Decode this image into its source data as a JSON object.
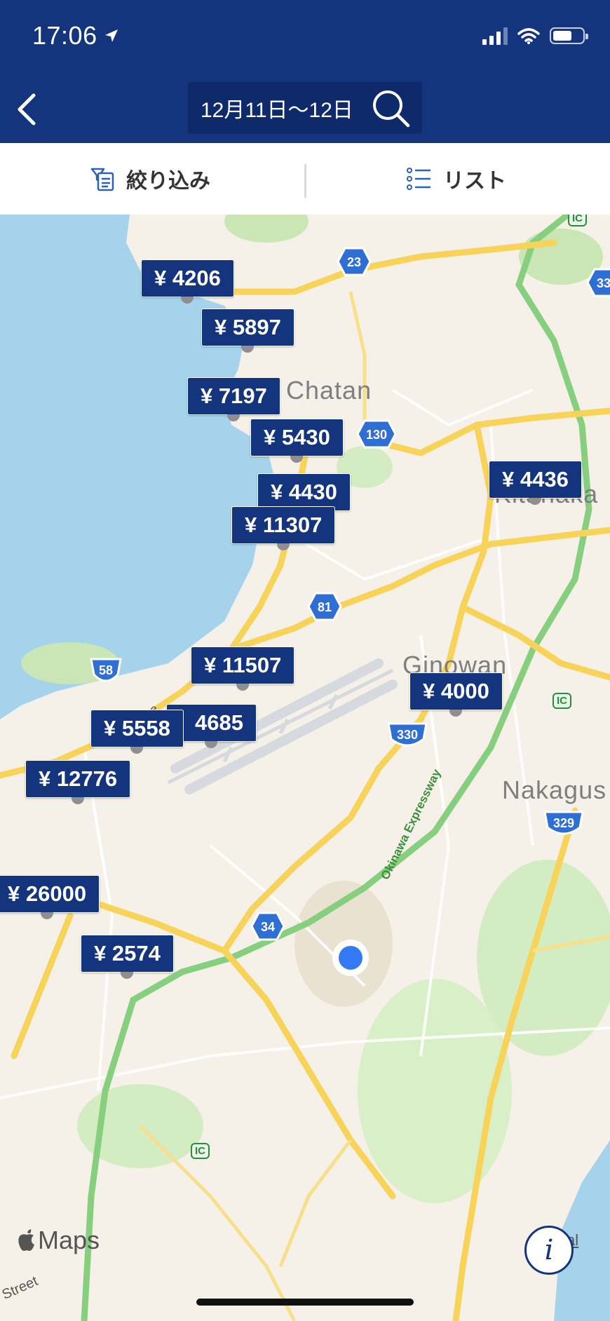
{
  "status_bar": {
    "time": "17:06"
  },
  "header": {
    "date_range": "12月11日〜12日"
  },
  "toolbar": {
    "filter_label": "絞り込み",
    "list_label": "リスト"
  },
  "map": {
    "places": {
      "chatan": "Chatan",
      "kitanaka": "Kitanaka",
      "ginowan": "Ginowan",
      "nakagus": "Nakagus"
    },
    "routes": {
      "r23": "23",
      "r130": "130",
      "r81": "81",
      "r58": "58",
      "r330": "330",
      "r329": "329",
      "r34": "34",
      "r33": "33"
    },
    "road_labels": {
      "pipe_line": "Pipe Line",
      "expressway": "Okinawa Expressway",
      "street": "Street"
    },
    "ic_label": "IC",
    "attribution_suffix": "al",
    "prices": [
      {
        "label": "¥ 4206"
      },
      {
        "label": "¥ 5897"
      },
      {
        "label": "¥ 7197"
      },
      {
        "label": "¥ 5430"
      },
      {
        "label": "¥ 4430"
      },
      {
        "label": "¥ 11307"
      },
      {
        "label": "¥ 4436"
      },
      {
        "label": "¥ 11507"
      },
      {
        "label": "¥ 4000"
      },
      {
        "label": "4685"
      },
      {
        "label": "¥ 5558"
      },
      {
        "label": "¥ 12776"
      },
      {
        "label": "¥ 26000"
      },
      {
        "label": "¥ 2574"
      }
    ]
  },
  "maps_logo": "Maps",
  "colors": {
    "header": "#14357e",
    "water": "#a6d3ec",
    "land": "#f5f1e8",
    "road": "#f7d35a",
    "expressway": "#85cf7e",
    "location": "#3478f6"
  }
}
